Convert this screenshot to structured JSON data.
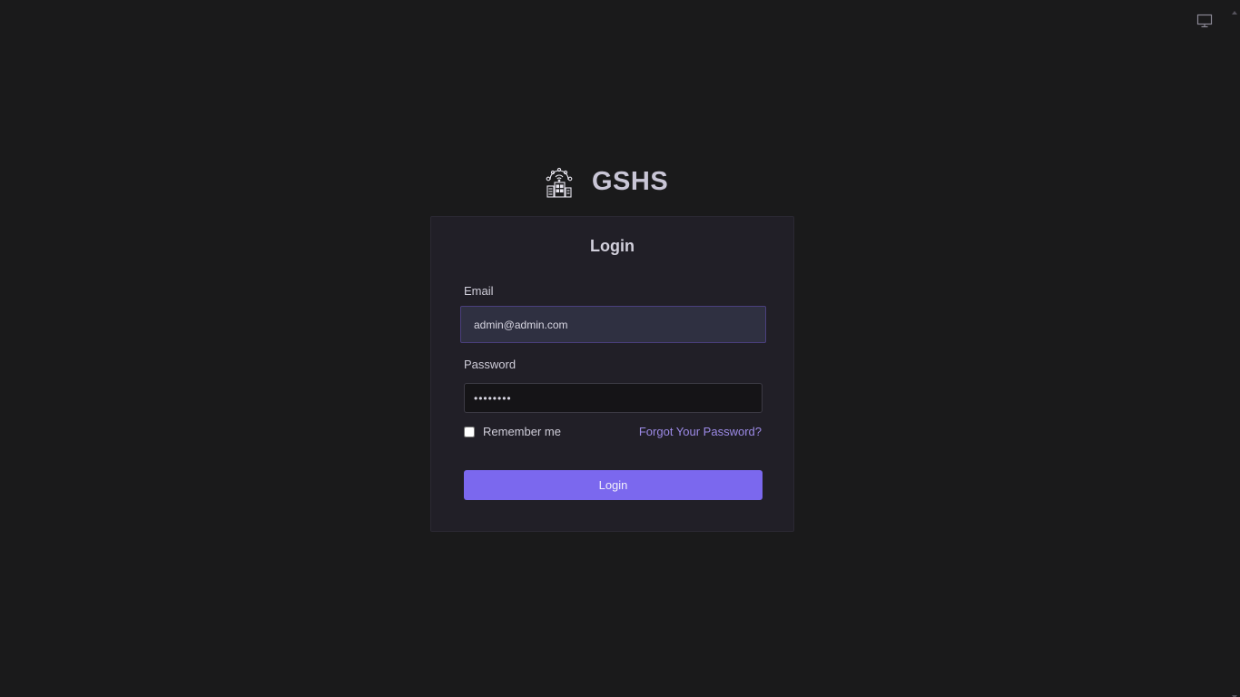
{
  "brand": {
    "name": "GSHS",
    "logo_icon": "smart-building-icon"
  },
  "top_bar": {
    "theme_toggle_icon": "monitor-icon"
  },
  "login_form": {
    "title": "Login",
    "email": {
      "label": "Email",
      "value": "admin@admin.com"
    },
    "password": {
      "label": "Password",
      "value": "••••••••"
    },
    "remember_me": {
      "label": "Remember me",
      "checked": false
    },
    "forgot_password_label": "Forgot Your Password?",
    "submit_label": "Login"
  },
  "colors": {
    "background": "#1a1a1b",
    "card": "#211f27",
    "accent": "#7b68ee",
    "link": "#9c8ae6"
  }
}
